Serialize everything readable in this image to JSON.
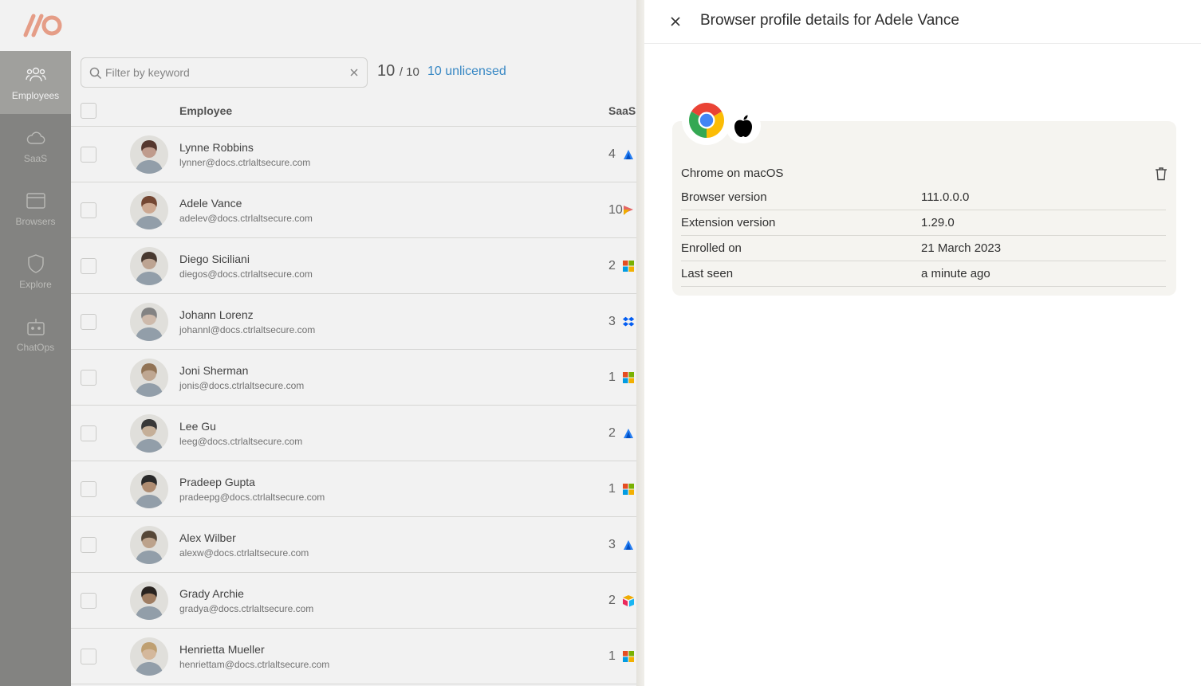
{
  "nav": {
    "items": [
      {
        "label": "Employees",
        "icon": "users-icon",
        "active": true
      },
      {
        "label": "SaaS",
        "icon": "cloud-icon",
        "active": false
      },
      {
        "label": "Browsers",
        "icon": "browser-window-icon",
        "active": false
      },
      {
        "label": "Explore",
        "icon": "shield-icon",
        "active": false
      },
      {
        "label": "ChatOps",
        "icon": "bot-icon",
        "active": false
      }
    ]
  },
  "filter": {
    "placeholder": "Filter by keyword",
    "value": "",
    "count_shown": "10",
    "count_total": "/ 10",
    "unlicensed_link": "10 unlicensed"
  },
  "table": {
    "columns": {
      "employee": "Employee",
      "saas": "SaaS"
    },
    "rows": [
      {
        "name": "Lynne Robbins",
        "email": "lynner@docs.ctrlaltsecure.com",
        "saas_count": "4",
        "saas_icon": "atlassian-icon"
      },
      {
        "name": "Adele Vance",
        "email": "adelev@docs.ctrlaltsecure.com",
        "saas_count": "10",
        "saas_icon": "asana-icon"
      },
      {
        "name": "Diego Siciliani",
        "email": "diegos@docs.ctrlaltsecure.com",
        "saas_count": "2",
        "saas_icon": "microsoft-icon"
      },
      {
        "name": "Johann Lorenz",
        "email": "johannl@docs.ctrlaltsecure.com",
        "saas_count": "3",
        "saas_icon": "dropbox-icon"
      },
      {
        "name": "Joni Sherman",
        "email": "jonis@docs.ctrlaltsecure.com",
        "saas_count": "1",
        "saas_icon": "microsoft-icon"
      },
      {
        "name": "Lee Gu",
        "email": "leeg@docs.ctrlaltsecure.com",
        "saas_count": "2",
        "saas_icon": "atlassian-icon"
      },
      {
        "name": "Pradeep Gupta",
        "email": "pradeepg@docs.ctrlaltsecure.com",
        "saas_count": "1",
        "saas_icon": "microsoft-icon"
      },
      {
        "name": "Alex Wilber",
        "email": "alexw@docs.ctrlaltsecure.com",
        "saas_count": "3",
        "saas_icon": "atlassian-icon"
      },
      {
        "name": "Grady Archie",
        "email": "gradya@docs.ctrlaltsecure.com",
        "saas_count": "2",
        "saas_icon": "airtable-icon"
      },
      {
        "name": "Henrietta Mueller",
        "email": "henriettam@docs.ctrlaltsecure.com",
        "saas_count": "1",
        "saas_icon": "microsoft-icon"
      }
    ]
  },
  "panel": {
    "title": "Browser profile details for Adele Vance",
    "profile": {
      "browser_icon": "chrome-icon",
      "os_icon": "apple-icon",
      "name": "Chrome on macOS",
      "details": [
        {
          "label": "Browser version",
          "value": "111.0.0.0"
        },
        {
          "label": "Extension version",
          "value": "1.29.0"
        },
        {
          "label": "Enrolled on",
          "value": "21 March 2023"
        },
        {
          "label": "Last seen",
          "value": "a minute ago"
        }
      ]
    }
  },
  "colors": {
    "brand_logo": "#f2a58e",
    "link": "#3a8fcf",
    "sidebar": "#8a8a87",
    "sidebar_active": "#a8a8a5",
    "card_bg": "#f5f4f0"
  }
}
